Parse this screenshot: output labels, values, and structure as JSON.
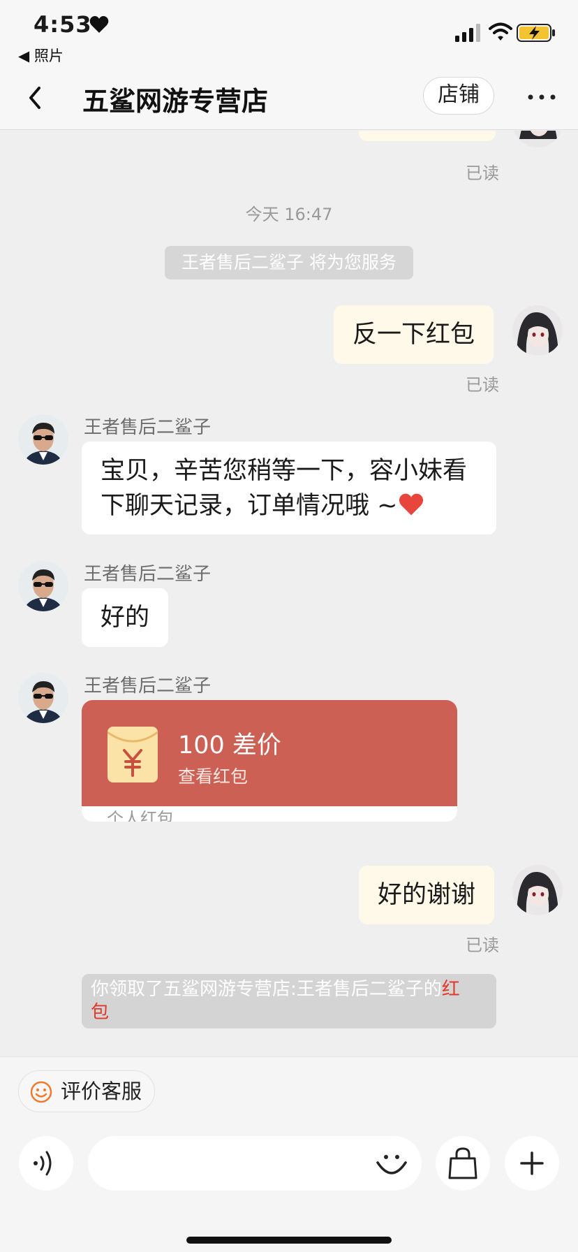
{
  "status_bar": {
    "time": "4:53",
    "back_to_app": "◀ 照片"
  },
  "header": {
    "title": "五鲨网游专营店",
    "shop_button": "店铺"
  },
  "chat": {
    "top_read": "已读",
    "timestamp": "今天 16:47",
    "system_notice": "王者售后二鲨子 将为您服务",
    "messages": [
      {
        "from": "me",
        "text": "反一下红包",
        "status": "已读"
      },
      {
        "from": "agent",
        "sender": "王者售后二鲨子",
        "line1": "宝贝，辛苦您稍等一下，容小妹看",
        "line2": "下聊天记录，订单情况哦 ~"
      },
      {
        "from": "agent",
        "sender": "王者售后二鲨子",
        "text": "好的"
      },
      {
        "from": "agent",
        "sender": "王者售后二鲨子",
        "redpacket": {
          "title": "100 差价",
          "subtitle": "查看红包",
          "footer": "个人红包"
        }
      },
      {
        "from": "me",
        "text": "好的谢谢",
        "status": "已读"
      }
    ],
    "received_notice": {
      "prefix": "你领取了五鲨网游专营店:王者售后二鲨子的",
      "highlight_1": "红",
      "highlight_2": "包"
    }
  },
  "footer": {
    "rate_button": "评价客服",
    "input_placeholder": ""
  },
  "colors": {
    "redpacket": "#cd6054",
    "my_bubble": "#fff9e9",
    "highlight": "#e2382b"
  }
}
